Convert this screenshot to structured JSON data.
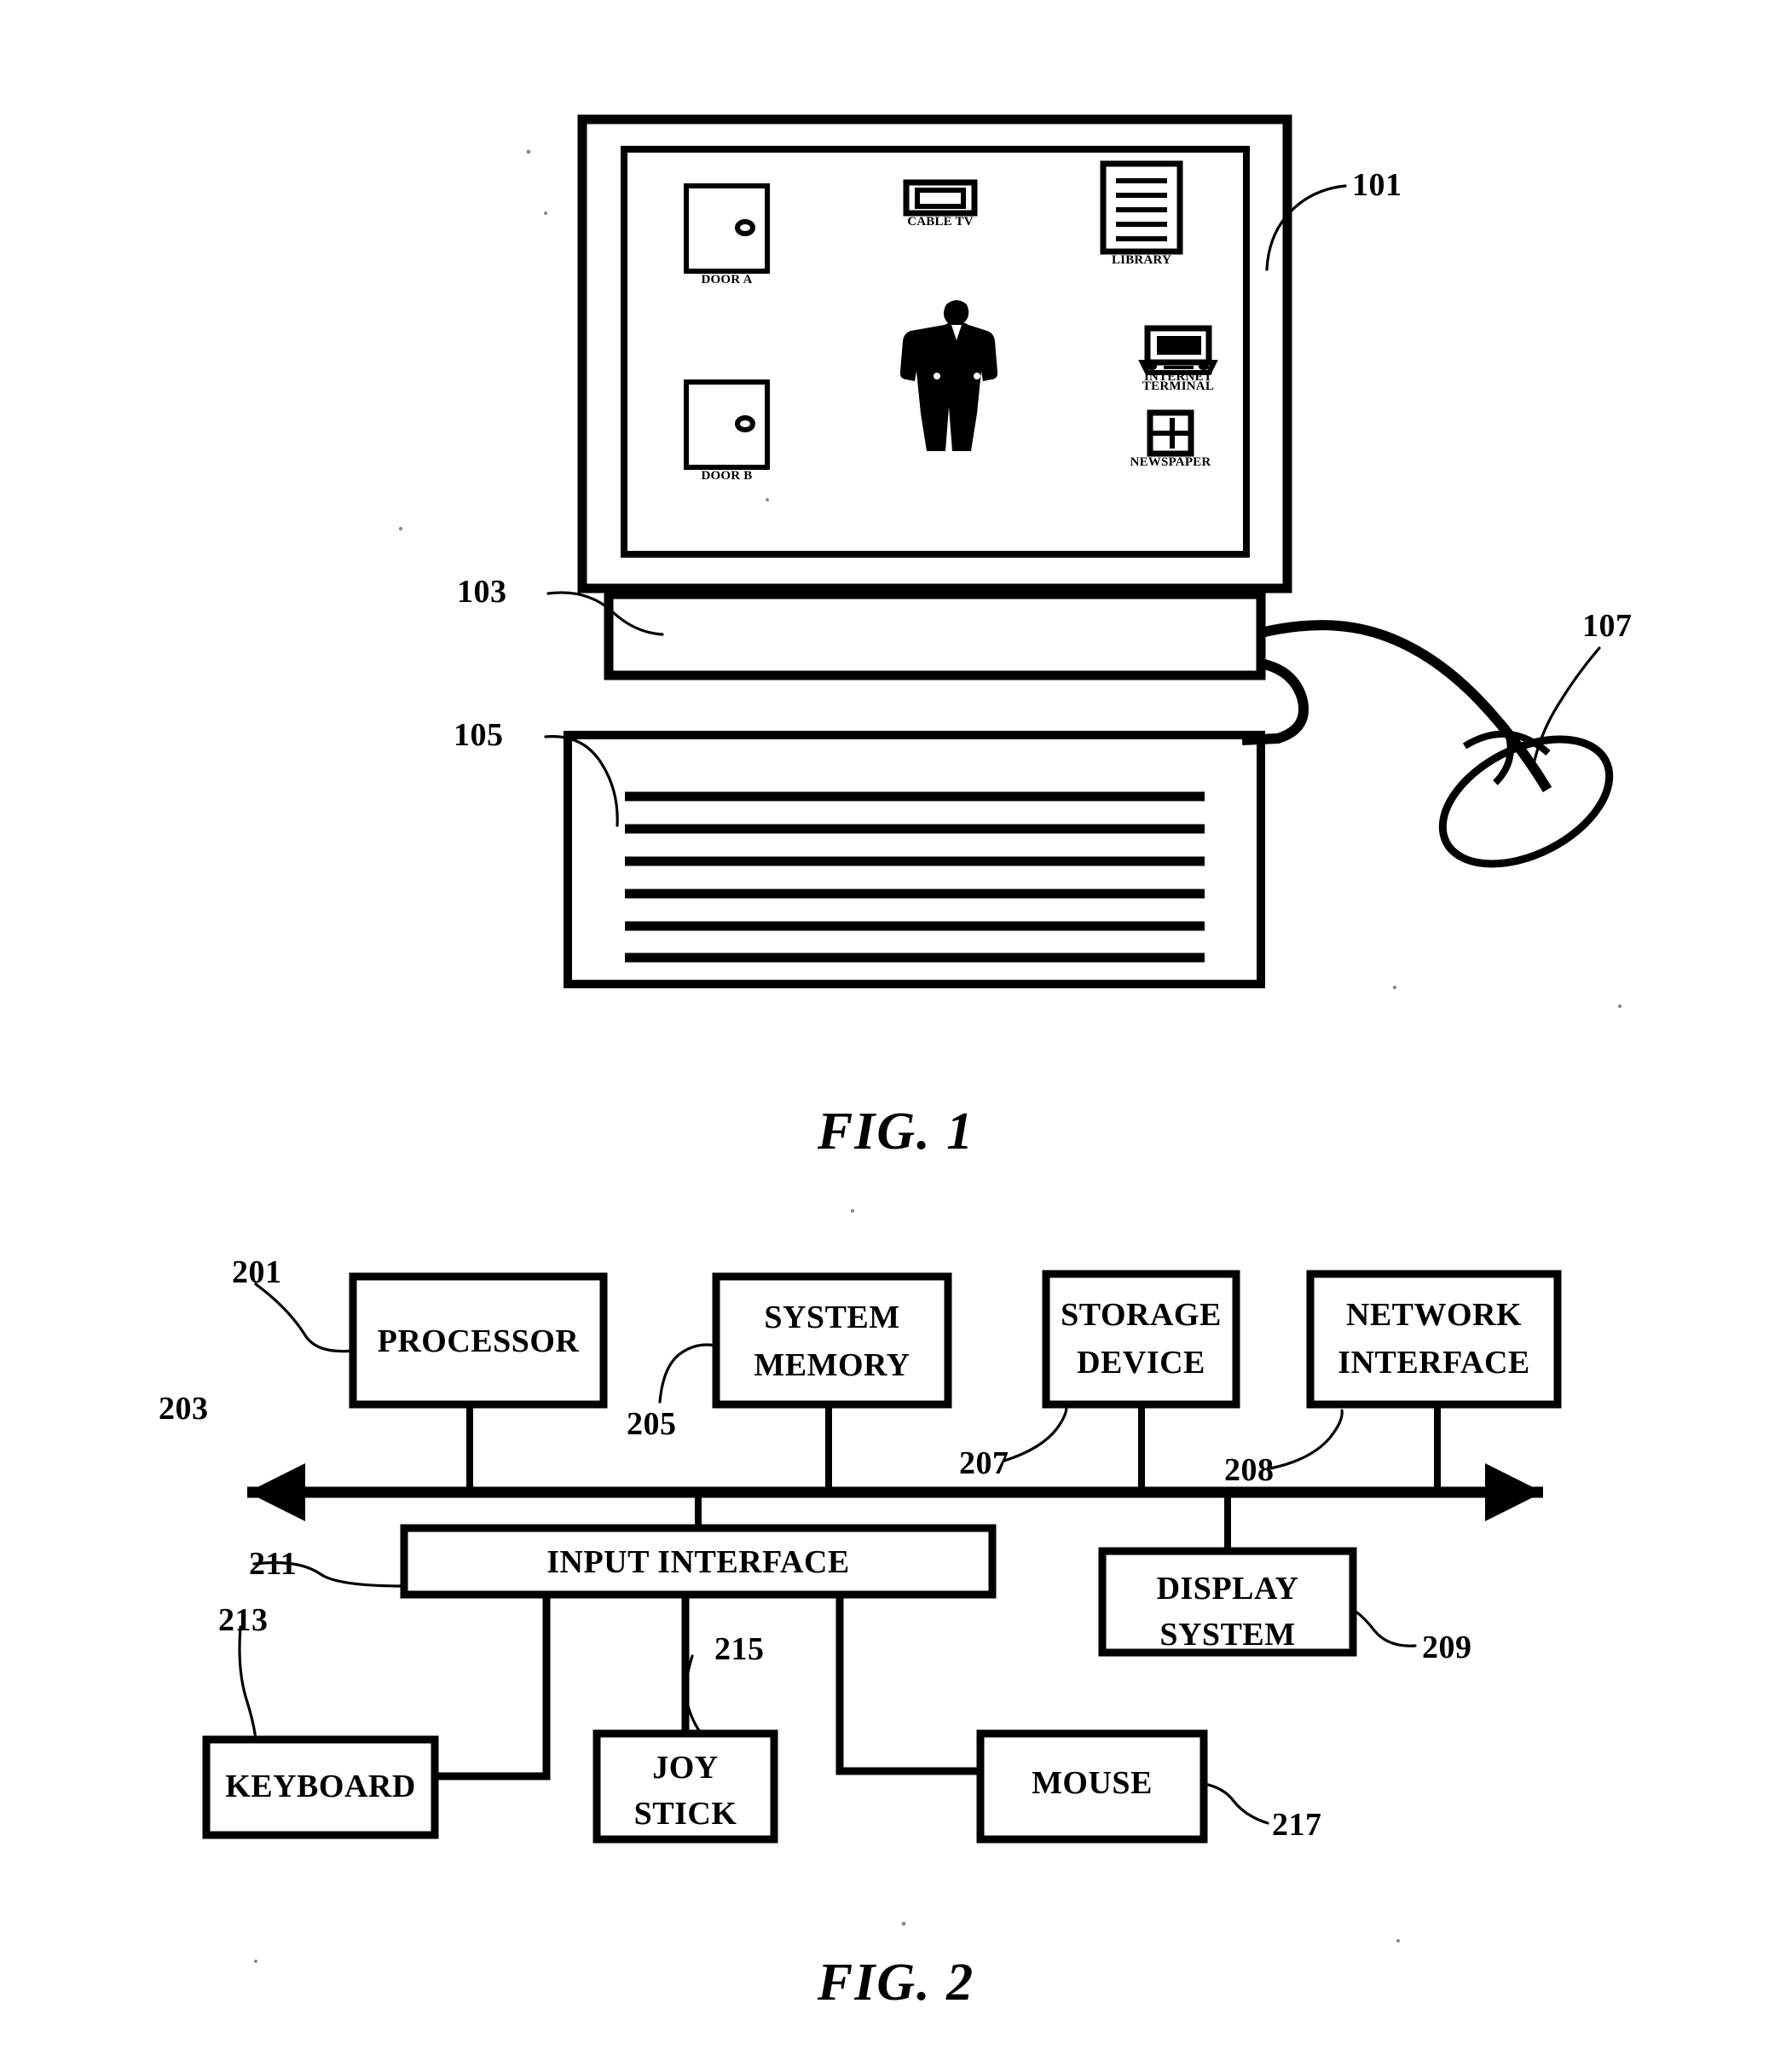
{
  "document": {
    "type": "patent-drawing-sheet",
    "background_color": "#ffffff",
    "ink_color": "#000000"
  },
  "figure1": {
    "caption": "FIG. 1",
    "reference_numerals": [
      {
        "id": "101",
        "label": "101",
        "points_to": "monitor-display"
      },
      {
        "id": "103",
        "label": "103",
        "points_to": "computer-base"
      },
      {
        "id": "105",
        "label": "105",
        "points_to": "keyboard"
      },
      {
        "id": "107",
        "label": "107",
        "points_to": "mouse"
      }
    ],
    "screen": {
      "avatar": {
        "name": "person-figure",
        "label": ""
      },
      "icons": [
        {
          "name": "door-a-icon",
          "label": "DOOR A",
          "shape": "door"
        },
        {
          "name": "door-b-icon",
          "label": "DOOR B",
          "shape": "door"
        },
        {
          "name": "cable-tv-icon",
          "label": "CABLE TV",
          "shape": "television"
        },
        {
          "name": "library-icon",
          "label": "LIBRARY",
          "shape": "document"
        },
        {
          "name": "internet-terminal-icon",
          "label_line1": "INTERNET",
          "label_line2": "TERMINAL",
          "shape": "laptop"
        },
        {
          "name": "newspaper-icon",
          "label": "NEWSPAPER",
          "shape": "newspaper"
        }
      ]
    },
    "keyboard": {
      "key_row_count": 6
    }
  },
  "figure2": {
    "caption": "FIG. 2",
    "bus": {
      "name": "system-bus",
      "numeral": "203",
      "bidirectional": true
    },
    "top_blocks": [
      {
        "numeral": "201",
        "label_lines": [
          "PROCESSOR"
        ],
        "name": "processor-block"
      },
      {
        "numeral": "205",
        "label_lines": [
          "SYSTEM",
          "MEMORY"
        ],
        "name": "system-memory-block"
      },
      {
        "numeral": "207",
        "label_lines": [
          "STORAGE",
          "DEVICE"
        ],
        "name": "storage-device-block"
      },
      {
        "numeral": "208",
        "label_lines": [
          "NETWORK",
          "INTERFACE"
        ],
        "name": "network-interface-block"
      }
    ],
    "mid_blocks": [
      {
        "numeral": "211",
        "label_lines": [
          "INPUT INTERFACE"
        ],
        "name": "input-interface-block"
      },
      {
        "numeral": "209",
        "label_lines": [
          "DISPLAY",
          "SYSTEM"
        ],
        "name": "display-system-block"
      }
    ],
    "bottom_blocks": [
      {
        "numeral": "213",
        "label_lines": [
          "KEYBOARD"
        ],
        "name": "keyboard-block"
      },
      {
        "numeral": "215",
        "label_lines": [
          "JOY",
          "STICK"
        ],
        "name": "joy-stick-block"
      },
      {
        "numeral": "217",
        "label_lines": [
          "MOUSE"
        ],
        "name": "mouse-block"
      }
    ]
  }
}
